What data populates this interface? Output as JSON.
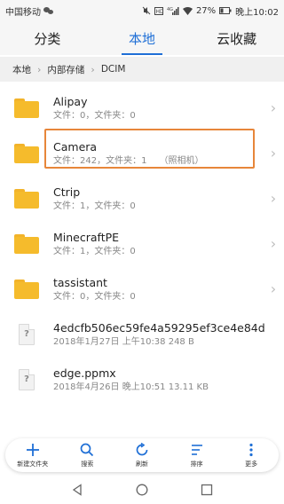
{
  "status_bar": {
    "carrier": "中国移动",
    "battery": "27%",
    "time": "晚上10:02"
  },
  "tabs": [
    {
      "label": "分类",
      "active": false
    },
    {
      "label": "本地",
      "active": true
    },
    {
      "label": "云收藏",
      "active": false
    }
  ],
  "breadcrumb": [
    "本地",
    "内部存储",
    "DCIM"
  ],
  "files": [
    {
      "name": "Alipay",
      "meta": "文件：0，文件夹：0",
      "extra": "",
      "type": "folder"
    },
    {
      "name": "Camera",
      "meta": "文件：242，文件夹：1",
      "extra": "（照相机）",
      "type": "folder",
      "highlighted": true
    },
    {
      "name": "Ctrip",
      "meta": "文件：1，文件夹：0",
      "extra": "",
      "type": "folder"
    },
    {
      "name": "MinecraftPE",
      "meta": "文件：1，文件夹：0",
      "extra": "",
      "type": "folder"
    },
    {
      "name": "tassistant",
      "meta": "文件：0，文件夹：0",
      "extra": "",
      "type": "folder"
    },
    {
      "name": "4edcfb506ec59fe4a59295ef3ce4e84d",
      "meta": "2018年1月27日 上午10:38 248 B",
      "extra": "",
      "type": "file"
    },
    {
      "name": "edge.ppmx",
      "meta": "2018年4月26日 晚上10:51 13.11 KB",
      "extra": "",
      "type": "file"
    }
  ],
  "toolbar": {
    "new_folder": "新建文件夹",
    "search": "搜索",
    "refresh": "刷新",
    "sort": "排序",
    "more": "更多"
  },
  "colors": {
    "accent": "#1f6fd6",
    "folder": "#f5bb2c",
    "highlight": "#e7863a"
  },
  "icons": {
    "doc_glyph": "?"
  }
}
